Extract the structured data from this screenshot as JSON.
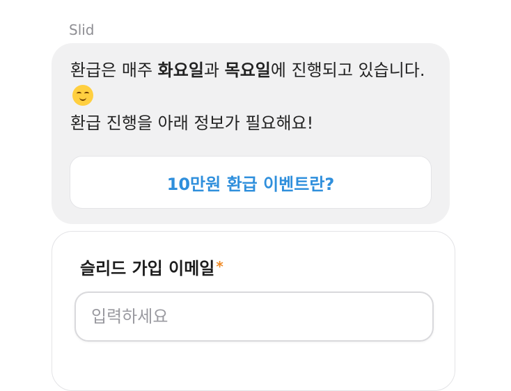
{
  "sender": "Slid",
  "message": {
    "part1": "환급은 매주 ",
    "bold1": "화요일",
    "part2": "과 ",
    "bold2": "목요일",
    "part3": "에 진행되고 있습니다.",
    "emoji": "smiling-face-icon",
    "line2": "환급 진행을 아래 정보가 필요해요!"
  },
  "cta_label": "10만원 환급 이벤트란?",
  "form": {
    "email_label": "슬리드 가입 이메일",
    "required_mark": "*",
    "email_placeholder": "입력하세요",
    "email_value": ""
  },
  "colors": {
    "accent": "#2f8fdc",
    "required": "#f08a24",
    "bubble_bg": "#f1f1f2"
  }
}
